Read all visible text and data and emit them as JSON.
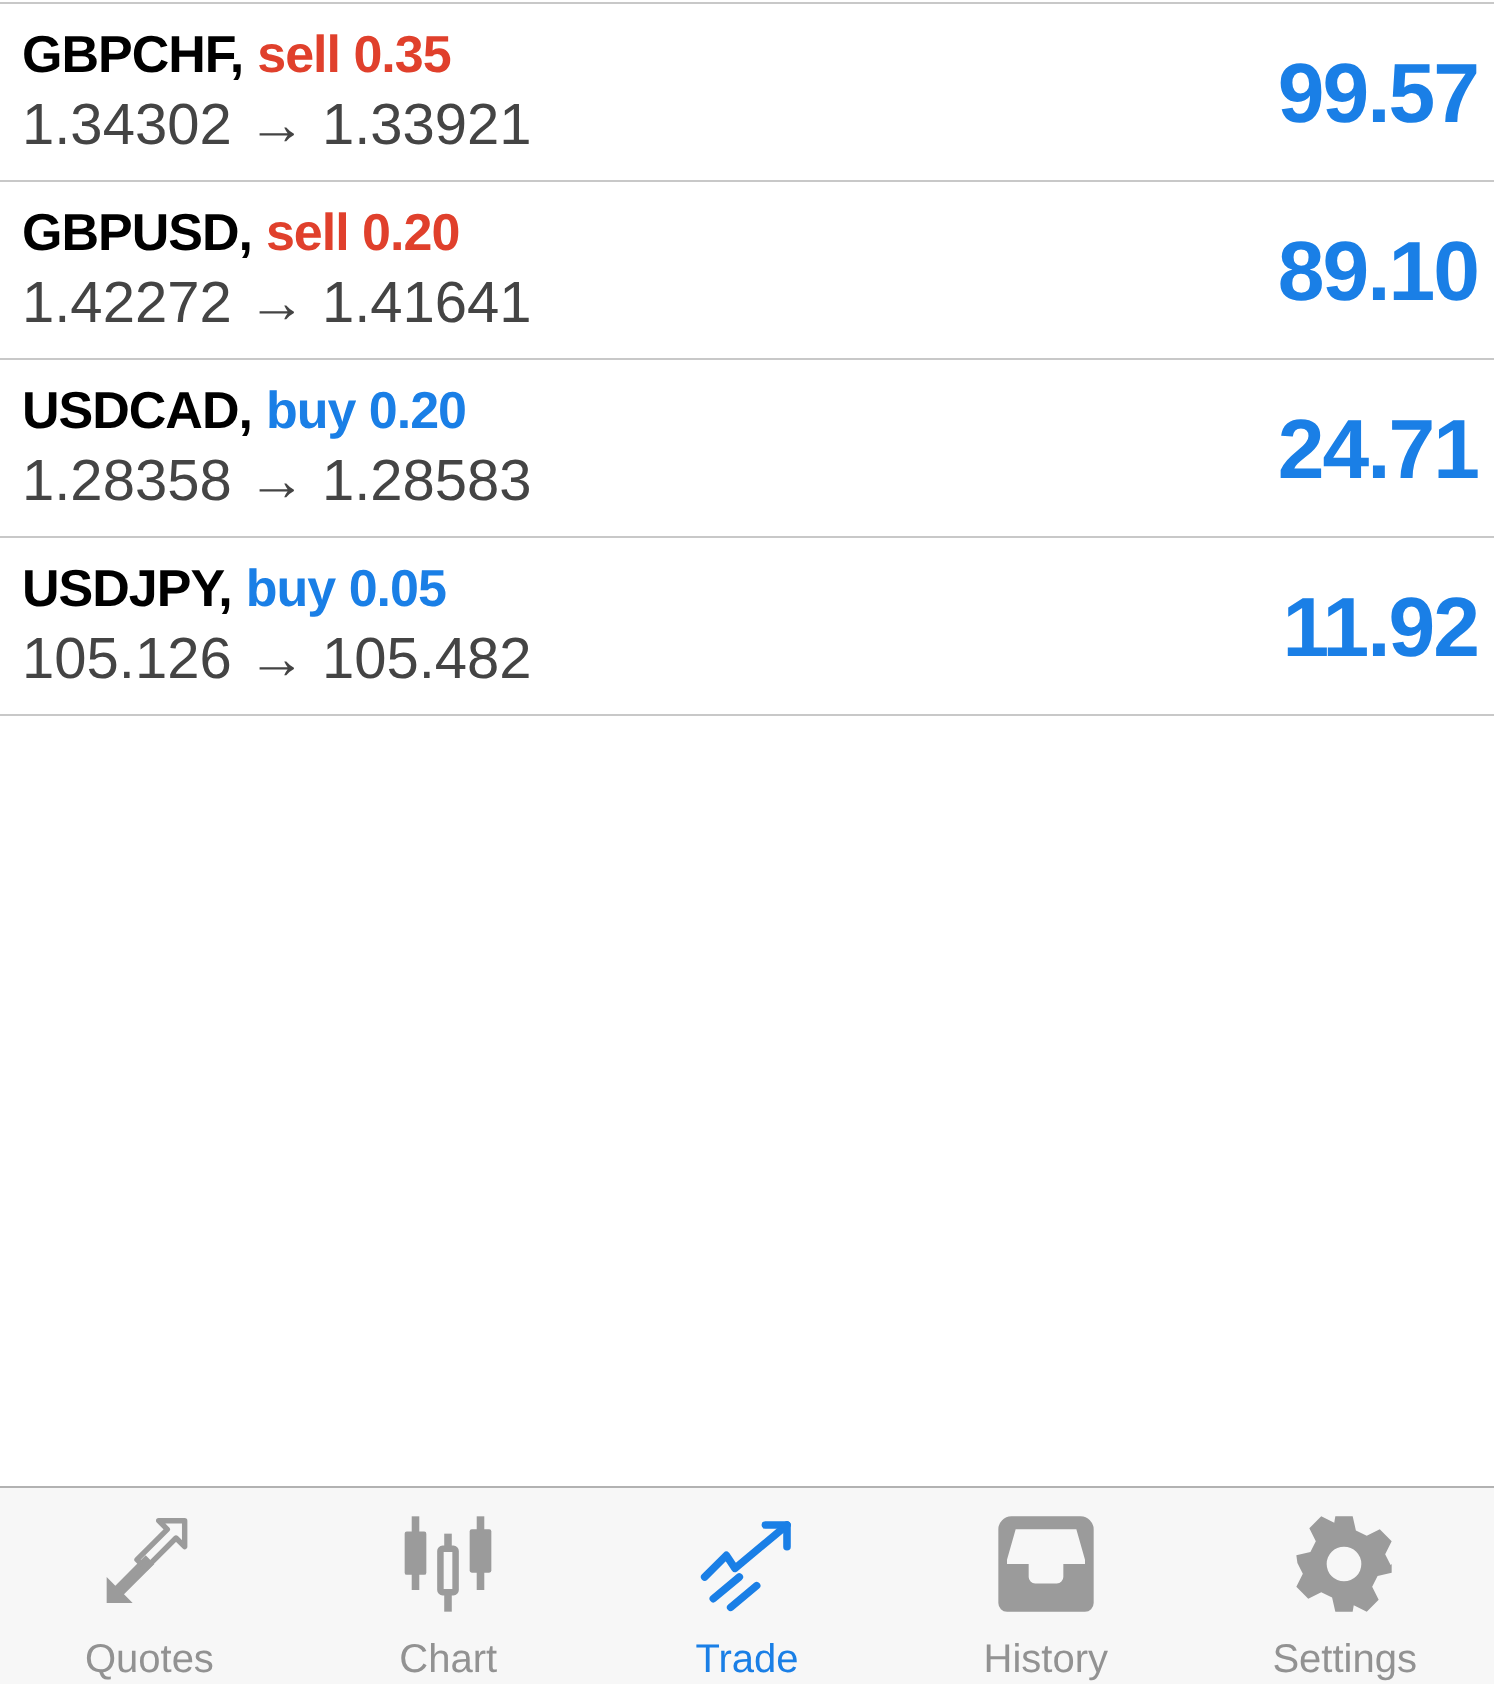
{
  "positions": [
    {
      "symbol": "GBPCHF,",
      "order": "sell 0.35",
      "color": "#e0402c",
      "prices": "1.34302 → 1.33921",
      "profit": "99.57"
    },
    {
      "symbol": "GBPUSD,",
      "order": "sell 0.20",
      "color": "#e0402c",
      "prices": "1.42272 → 1.41641",
      "profit": "89.10"
    },
    {
      "symbol": "USDCAD,",
      "order": "buy 0.20",
      "color": "#1a7fe6",
      "prices": "1.28358 → 1.28583",
      "profit": "24.71"
    },
    {
      "symbol": "USDJPY,",
      "order": "buy 0.05",
      "color": "#1a7fe6",
      "prices": "105.126 → 105.482",
      "profit": "11.92"
    }
  ],
  "tab_bar": [
    {
      "label": "Quotes",
      "selected": false
    },
    {
      "label": "Chart",
      "selected": false
    },
    {
      "label": "Trade",
      "selected": true
    },
    {
      "label": "History",
      "selected": false
    },
    {
      "label": "Settings",
      "selected": false
    }
  ]
}
